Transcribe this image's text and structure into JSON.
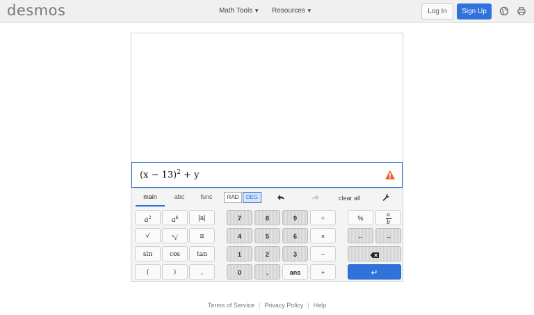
{
  "header": {
    "logo": "desmos",
    "nav": [
      {
        "label": "Math Tools"
      },
      {
        "label": "Resources"
      }
    ],
    "login_label": "Log In",
    "signup_label": "Sign Up",
    "icons": [
      "globe-icon",
      "printer-icon"
    ]
  },
  "expression": {
    "base": "(x − 13)",
    "exponent": "2",
    "rest": " + y",
    "status_icon": "warning-icon"
  },
  "keypad": {
    "tabs": [
      "main",
      "abc",
      "func"
    ],
    "active_tab": "main",
    "angle_modes": [
      "RAD",
      "DEG"
    ],
    "active_mode": "DEG",
    "undo_icon": "undo-icon",
    "redo_icon": "redo-icon",
    "clear_all": "clear all",
    "settings_icon": "wrench-icon",
    "function_keys": {
      "abs": "|a|",
      "pi": "π",
      "sin": "sin",
      "cos": "cos",
      "tan": "tan",
      "lparen": "(",
      "rparen": ")",
      "comma": ","
    },
    "number_keys": {
      "k7": "7",
      "k8": "8",
      "k9": "9",
      "k4": "4",
      "k5": "5",
      "k6": "6",
      "k1": "1",
      "k2": "2",
      "k3": "3",
      "k0": "0",
      "dot": ".",
      "ans": "ans"
    },
    "operator_keys": {
      "divide": "÷",
      "times": "×",
      "minus": "−",
      "plus": "+",
      "percent": "%"
    },
    "arrow_keys": {
      "left": "←",
      "right": "→",
      "backspace_icon": "backspace-icon",
      "enter": "↵"
    }
  },
  "colors": {
    "accent": "#2f72dc",
    "warning": "#e8602c"
  },
  "footer": {
    "links": [
      "Terms of Service",
      "Privacy Policy",
      "Help"
    ]
  }
}
